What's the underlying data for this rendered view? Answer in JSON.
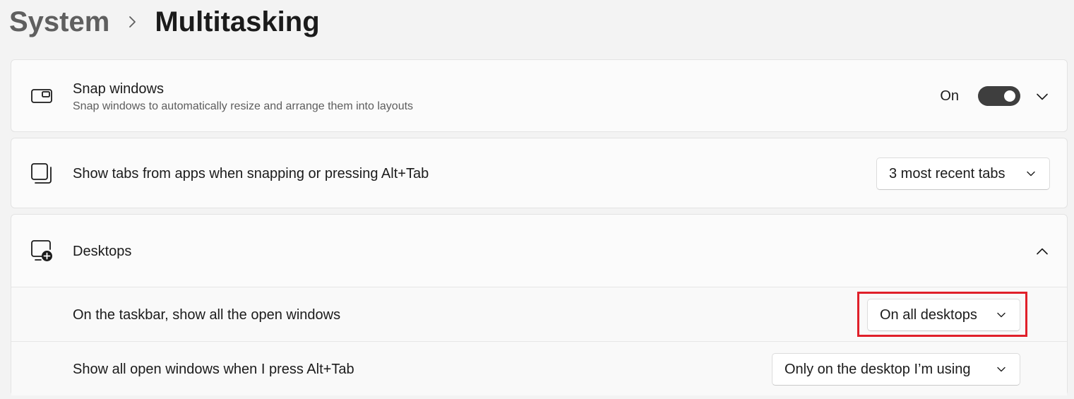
{
  "breadcrumb": {
    "parent": "System",
    "current": "Multitasking"
  },
  "snap_windows": {
    "title": "Snap windows",
    "description": "Snap windows to automatically resize and arrange them into layouts",
    "toggle_label": "On",
    "toggle_state": "on",
    "icon": "snap-layout-icon"
  },
  "show_tabs": {
    "title": "Show tabs from apps when snapping or pressing Alt+Tab",
    "selected": "3 most recent tabs",
    "icon": "stacked-windows-icon"
  },
  "desktops": {
    "title": "Desktops",
    "icon": "add-desktop-icon",
    "expanded": true,
    "rows": [
      {
        "label": "On the taskbar, show all the open windows",
        "selected": "On all desktops"
      },
      {
        "label": "Show all open windows when I press Alt+Tab",
        "selected": "Only on the desktop I’m using"
      }
    ]
  },
  "colors": {
    "highlight_box": "#e0202a",
    "toggle_on": "#3e3e3e"
  }
}
